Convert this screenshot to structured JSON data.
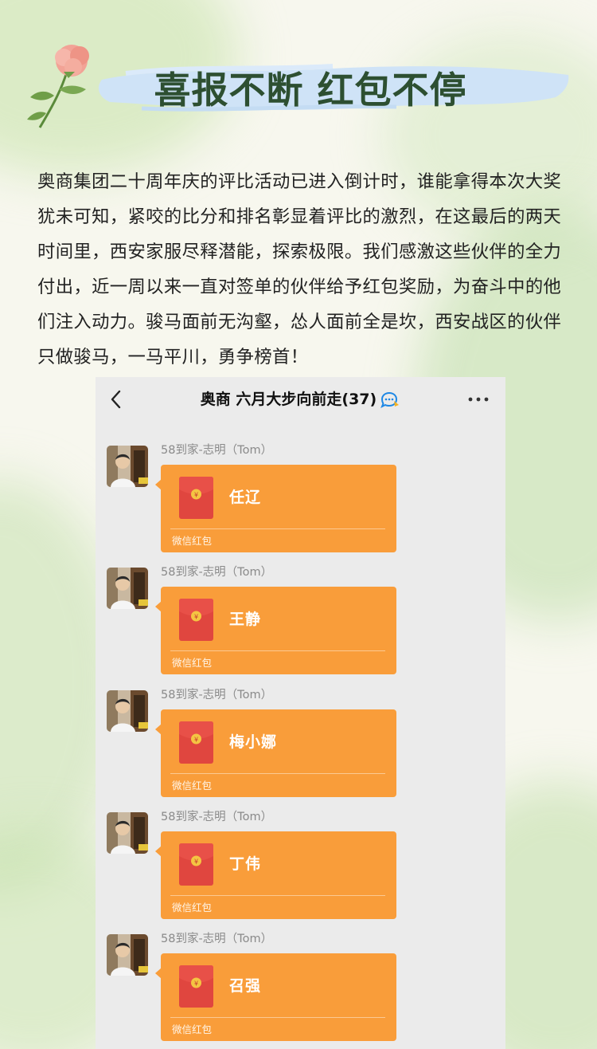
{
  "page": {
    "title": "喜报不断 红包不停",
    "body": "奥商集团二十周年庆的评比活动已进入倒计时，谁能拿得本次大奖犹未可知，紧咬的比分和排名彰显着评比的激烈，在这最后的两天时间里，西安家服尽释潜能，探索极限。我们感激这些伙伴的全力付出，近一周以来一直对签单的伙伴给予红包奖励，为奋斗中的他们注入动力。骏马面前无沟壑，怂人面前全是坎，西安战区的伙伴只做骏马，一马平川，勇争榜首！"
  },
  "chat": {
    "title": "奥商 六月大步向前走",
    "member_count": "(37)",
    "messages": [
      {
        "sender": "58到家-志明（Tom）",
        "name": "任辽",
        "label": "微信红包"
      },
      {
        "sender": "58到家-志明（Tom）",
        "name": "王静",
        "label": "微信红包"
      },
      {
        "sender": "58到家-志明（Tom）",
        "name": "梅小娜",
        "label": "微信红包"
      },
      {
        "sender": "58到家-志明（Tom）",
        "name": "丁伟",
        "label": "微信红包"
      },
      {
        "sender": "58到家-志明（Tom）",
        "name": "召强",
        "label": "微信红包"
      }
    ]
  },
  "icons": {
    "back": "chevron-left-icon",
    "group": "group-chat-icon",
    "more": "more-dots-icon",
    "envelope": "red-envelope-icon"
  },
  "colors": {
    "title": "#2d4f31",
    "brush": "#cfe3f7",
    "packet": "#f99d3a",
    "envelope": "#e0463f",
    "chat_bg": "#ebebeb"
  }
}
